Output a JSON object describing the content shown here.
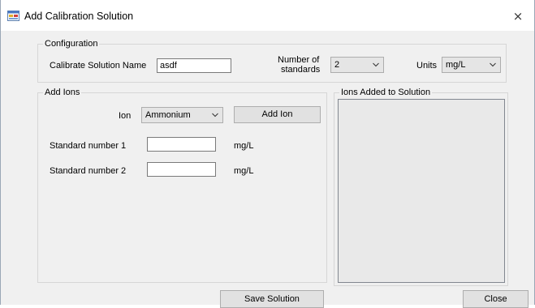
{
  "window": {
    "title": "Add Calibration Solution",
    "close_glyph": "×"
  },
  "configuration": {
    "legend": "Configuration",
    "solution_name_label": "Calibrate Solution Name",
    "solution_name_value": "asdf",
    "num_standards_label_line1": "Number of",
    "num_standards_label_line2": "standards",
    "num_standards_value": "2",
    "units_label": "Units",
    "units_value": "mg/L"
  },
  "add_ions": {
    "legend": "Add Ions",
    "ion_label": "Ion",
    "ion_value": "Ammonium",
    "add_ion_button": "Add Ion",
    "standards": [
      {
        "label": "Standard number 1",
        "value": "",
        "unit": "mg/L"
      },
      {
        "label": "Standard number 2",
        "value": "",
        "unit": "mg/L"
      }
    ]
  },
  "ions_added": {
    "legend": "Ions Added to Solution",
    "items": []
  },
  "footer": {
    "save_button": "Save Solution",
    "close_button": "Close"
  },
  "icons": {
    "app": "app-form-icon",
    "close": "close-icon",
    "dropdown": "chevron-down-icon"
  },
  "colors": {
    "window_bg": "#f0f0f0",
    "titlebar_bg": "#ffffff",
    "button_bg": "#e1e1e1",
    "listbox_bg": "#e9e9e9"
  }
}
